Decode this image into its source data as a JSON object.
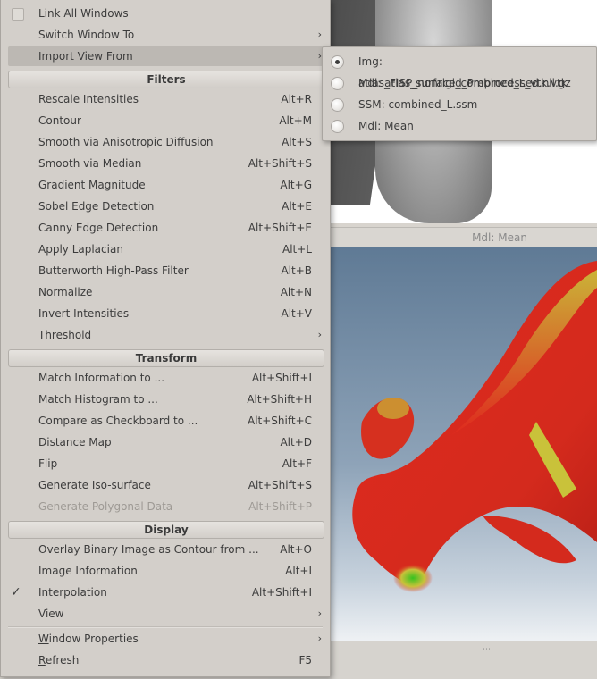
{
  "menu": {
    "top_items": [
      {
        "label": "Link All Windows",
        "checked": false
      },
      {
        "label": "Switch Window To",
        "has_submenu": true
      },
      {
        "label": "Import View From",
        "has_submenu": true,
        "highlighted": true
      }
    ],
    "sections": {
      "filters": "Filters",
      "transform": "Transform",
      "display": "Display"
    },
    "filters": [
      {
        "label": "Rescale Intensities",
        "shortcut": "Alt+R"
      },
      {
        "label": "Contour",
        "shortcut": "Alt+M"
      },
      {
        "label": "Smooth via Anisotropic Diffusion",
        "shortcut": "Alt+S"
      },
      {
        "label": "Smooth via Median",
        "shortcut": "Alt+Shift+S"
      },
      {
        "label": "Gradient Magnitude",
        "shortcut": "Alt+G"
      },
      {
        "label": "Sobel Edge Detection",
        "shortcut": "Alt+E"
      },
      {
        "label": "Canny Edge Detection",
        "shortcut": "Alt+Shift+E"
      },
      {
        "label": "Apply Laplacian",
        "shortcut": "Alt+L"
      },
      {
        "label": "Butterworth High-Pass Filter",
        "shortcut": "Alt+B"
      },
      {
        "label": "Normalize",
        "shortcut": "Alt+N"
      },
      {
        "label": "Invert Intensities",
        "shortcut": "Alt+V"
      },
      {
        "label": "Threshold",
        "shortcut": ""
      }
    ],
    "transform": [
      {
        "label": "Match Information to ...",
        "shortcut": "Alt+Shift+I"
      },
      {
        "label": "Match Histogram to ...",
        "shortcut": "Alt+Shift+H"
      },
      {
        "label": "Compare as Checkboard to ...",
        "shortcut": "Alt+Shift+C"
      },
      {
        "label": "Distance Map",
        "shortcut": "Alt+D"
      },
      {
        "label": "Flip",
        "shortcut": "Alt+F"
      },
      {
        "label": "Generate Iso-surface",
        "shortcut": "Alt+Shift+S"
      },
      {
        "label": "Generate Polygonal Data",
        "shortcut": "Alt+Shift+P",
        "disabled": true
      }
    ],
    "display": [
      {
        "label": "Overlay Binary Image as Contour from ...",
        "shortcut": "Alt+O"
      },
      {
        "label": "Image Information",
        "shortcut": "Alt+I"
      },
      {
        "label": "Interpolation",
        "shortcut": "Alt+Shift+I",
        "checked": true
      },
      {
        "label": "View",
        "shortcut": ""
      }
    ],
    "bottom": {
      "window_properties_first": "W",
      "window_properties_rest": "indow Properties",
      "refresh_first": "R",
      "refresh_rest": "efresh",
      "refresh_shortcut": "F5"
    }
  },
  "submenu": {
    "items": [
      {
        "label": "Img: atlas_FISP_nonrigid_Preprocessed.nii.gz",
        "selected": true
      },
      {
        "label": "Mdl: atlas_surface_combined_L_vtk.vtk",
        "selected": false
      },
      {
        "label": "SSM: combined_L.ssm",
        "selected": false
      },
      {
        "label": "Mdl: Mean",
        "selected": false
      }
    ]
  },
  "viewport": {
    "label": "Mdl: Mean",
    "grip": "⋯"
  },
  "glyphs": {
    "submenu_arrow": "›",
    "check": "✓"
  },
  "colors": {
    "menu_bg": "#d3cfca",
    "highlight": "#bcb8b3",
    "mesh_red": "#e0291e",
    "mesh_yellow": "#c9c23a",
    "mesh_green": "#37c21f"
  }
}
